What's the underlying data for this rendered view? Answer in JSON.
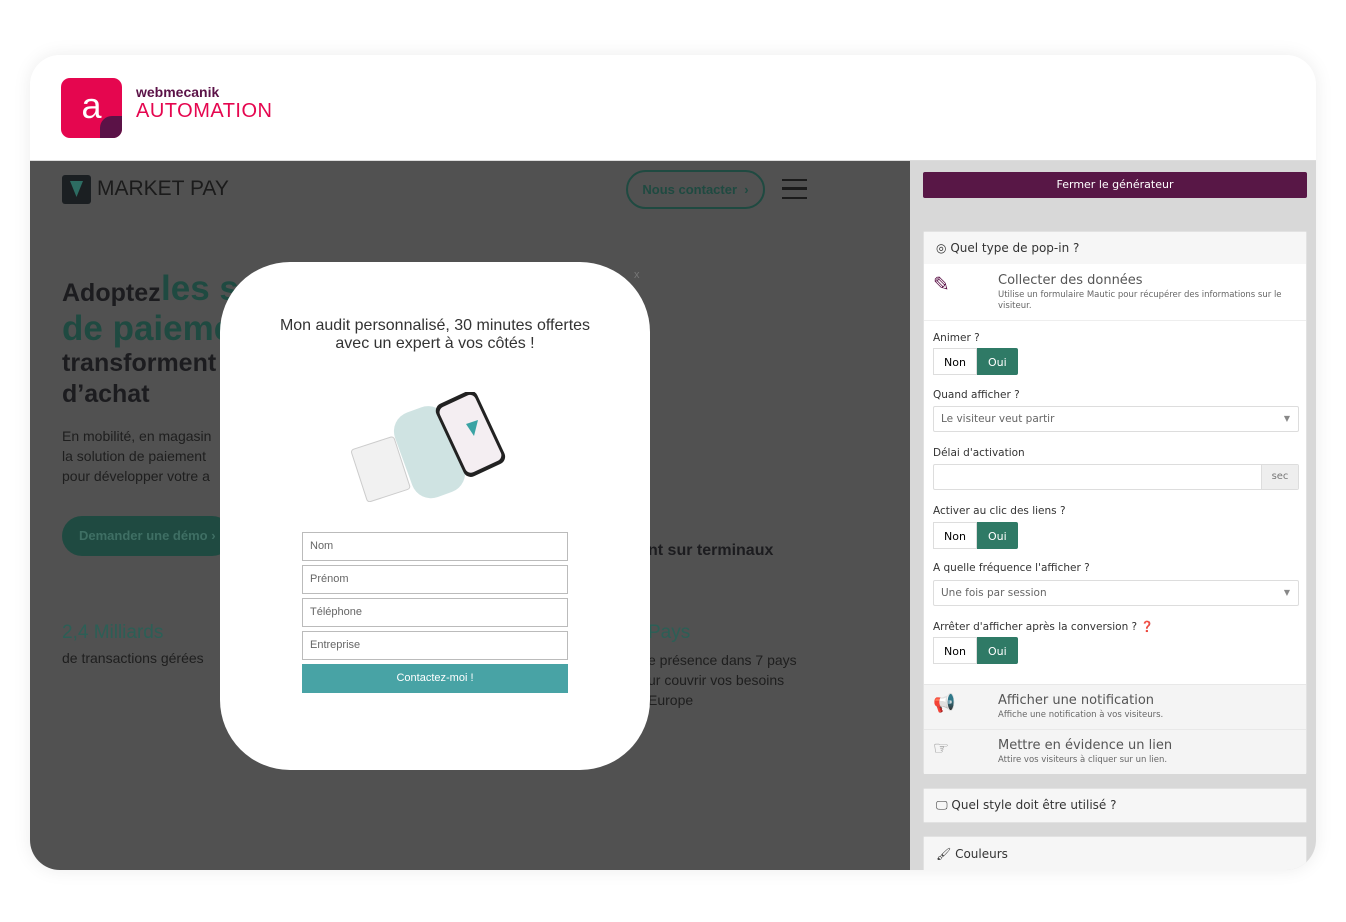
{
  "brand": {
    "logo_letter": "a",
    "line1": "webmecanik",
    "line2": "AUTOMATION"
  },
  "site": {
    "logo_text": "MARKET PAY",
    "contact_button": "Nous contacter",
    "hero_dark1": "Adoptez",
    "hero_green1": "les s",
    "hero_green2": "de paieme",
    "hero_dark2": "transforment l",
    "hero_dark3": "d’achat",
    "desc": [
      "En mobilité, en magasin",
      "la solution de paiement",
      "pour développer votre a"
    ],
    "demo_button": "Demander une démo",
    "right_heading": "nt sur terminaux",
    "stat1_value": "2,4 Milliards",
    "stat1_label": "de transactions gérées",
    "stat2_value": "Pays",
    "stat2_lines": [
      "e présence dans 7 pays",
      "ur couvrir vos besoins",
      "Europe"
    ]
  },
  "popup": {
    "close": "x",
    "title_line1": "Mon audit personnalisé, 30 minutes offertes",
    "title_line2": "avec un expert à vos côtés !",
    "fields": [
      "Nom",
      "Prénom",
      "Téléphone",
      "Entreprise"
    ],
    "submit": "Contactez-moi !"
  },
  "sidebar": {
    "close_generator": "Fermer le générateur",
    "type_section": "Quel type de pop-in ?",
    "collect": {
      "name": "Collecter des données",
      "desc": "Utilise un formulaire Mautic pour récupérer des informations sur le visiteur."
    },
    "animate_label": "Animer ?",
    "when_label": "Quand afficher ?",
    "when_value": "Le visiteur veut partir",
    "delay_label": "Délai d'activation",
    "delay_value": "",
    "delay_unit": "sec",
    "click_label": "Activer au clic des liens ?",
    "freq_label": "A quelle fréquence l'afficher ?",
    "freq_value": "Une fois par session",
    "stop_label": "Arrêter d'afficher après la conversion ?",
    "toggle_no": "Non",
    "toggle_yes": "Oui",
    "toggles": {
      "animate": "Oui",
      "click": "Oui",
      "stop": "Oui"
    },
    "notif": {
      "name": "Afficher une notification",
      "desc": "Affiche une notification à vos visiteurs."
    },
    "link": {
      "name": "Mettre en évidence un lien",
      "desc": "Attire vos visiteurs à cliquer sur un lien."
    },
    "style_section": "Quel style doit être utilisé ?",
    "colors_section": "Couleurs"
  },
  "colors": {
    "brand_pink": "#e5064f",
    "brand_purple": "#5b1247",
    "toggle_on": "#2f7a66",
    "popup_button": "#48a3a5",
    "close_button": "#581746"
  }
}
